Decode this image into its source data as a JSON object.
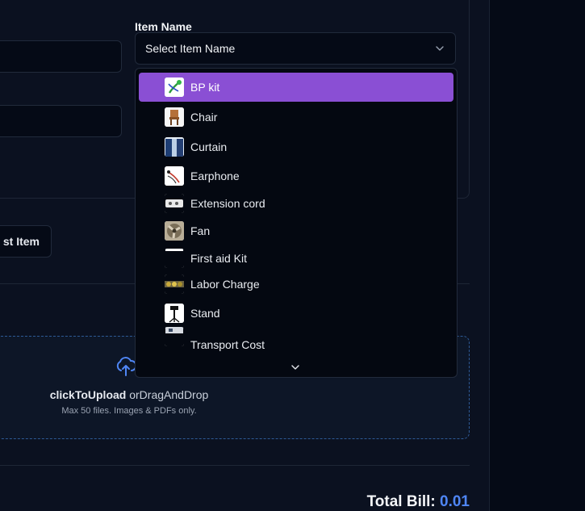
{
  "form": {
    "item_name_label": "Item Name",
    "item_name_placeholder": "Select Item Name",
    "last_item_button": "st Item"
  },
  "dropdown": {
    "options": [
      {
        "label": "BP kit",
        "icon": "bp-kit-thumbnail",
        "selected": true
      },
      {
        "label": "Chair",
        "icon": "chair-thumbnail"
      },
      {
        "label": "Curtain",
        "icon": "curtain-thumbnail"
      },
      {
        "label": "Earphone",
        "icon": "earphone-thumbnail"
      },
      {
        "label": "Extension cord",
        "icon": "extension-cord-thumbnail"
      },
      {
        "label": "Fan",
        "icon": "fan-thumbnail"
      },
      {
        "label": "First aid Kit",
        "icon": "first-aid-kit-thumbnail"
      },
      {
        "label": "Labor Charge",
        "icon": "labor-charge-thumbnail"
      },
      {
        "label": "Stand",
        "icon": "stand-thumbnail"
      },
      {
        "label": "Transport Cost",
        "icon": "transport-cost-thumbnail"
      }
    ]
  },
  "upload": {
    "click_text": "clickToUpload",
    "drag_text": "orDragAndDrop",
    "hint": "Max 50 files. Images & PDFs only."
  },
  "total": {
    "label": "Total Bill:",
    "amount": "0.01"
  },
  "colors": {
    "accent": "#8a4fd4",
    "link": "#4f86f5",
    "background": "#050a16"
  }
}
